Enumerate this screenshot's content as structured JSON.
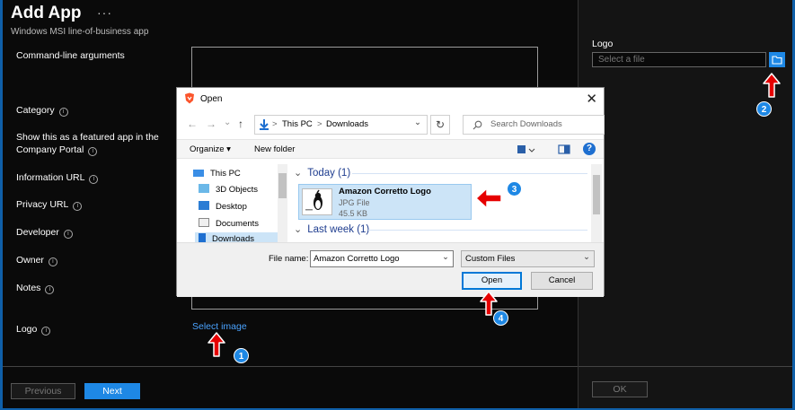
{
  "app": {
    "title": "Add App",
    "more": "···",
    "subtitle": "Windows MSI line-of-business app"
  },
  "form": {
    "fields": [
      "Command-line arguments",
      "Category",
      "Show this as a featured app in the",
      "Company Portal",
      "Information URL",
      "Privacy URL",
      "Developer",
      "Owner",
      "Notes",
      "Logo"
    ],
    "info_glyph": "i",
    "select_image": "Select image"
  },
  "footer": {
    "previous": "Previous",
    "next": "Next"
  },
  "logo_panel": {
    "label": "Logo",
    "placeholder": "Select a file",
    "ok": "OK"
  },
  "dialog": {
    "title": "Open",
    "close_glyph": "✕",
    "nav": {
      "back": "←",
      "forward": "→",
      "recent": "⌄",
      "up": "↑"
    },
    "path": [
      "This PC",
      "Downloads"
    ],
    "path_sep": ">",
    "dropdown_glyph": "⌄",
    "refresh_glyph": "↻",
    "search_placeholder": "Search Downloads",
    "toolbar": {
      "organize": "Organize ▾",
      "new_folder": "New folder",
      "help": "?"
    },
    "nav_items": [
      "This PC",
      "3D Objects",
      "Desktop",
      "Documents",
      "Downloads"
    ],
    "groups": [
      {
        "header": "Today (1)"
      },
      {
        "header": "Last week (1)"
      }
    ],
    "file": {
      "name": "Amazon Corretto Logo",
      "type": "JPG File",
      "size": "45.5 KB"
    },
    "filename_label": "File name:",
    "filename_value": "Amazon Corretto Logo",
    "filetype_value": "Custom Files",
    "open": "Open",
    "cancel": "Cancel"
  },
  "steps": [
    "1",
    "2",
    "3",
    "4"
  ],
  "colors": {
    "accent": "#1e88e5",
    "annotation_arrow": "#e60000",
    "link": "#4aa3ff",
    "selection": "#cce4f7"
  }
}
